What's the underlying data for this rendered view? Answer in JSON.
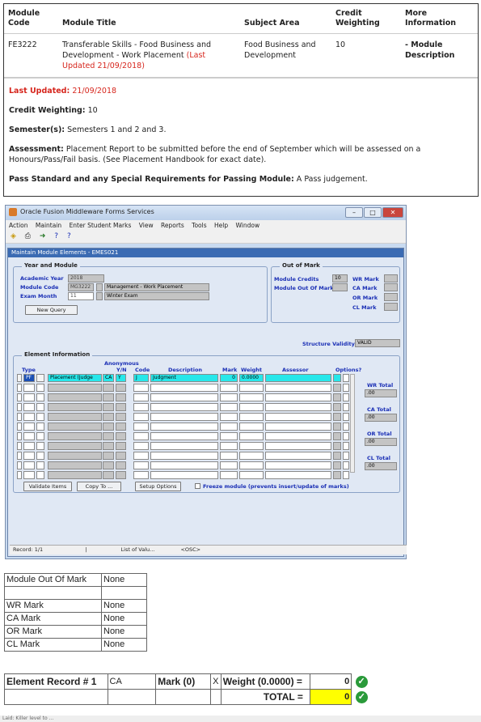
{
  "module_info": {
    "headers": [
      "Module Code",
      "Module Title",
      "Subject Area",
      "Credit Weighting",
      "More Information"
    ],
    "row": {
      "code": "FE3222",
      "title": "Transferable Skills - Food Business and Development - Work Placement",
      "title_updated": "(Last Updated 21/09/2018)",
      "subject": "Food Business and Development",
      "credit": "10",
      "more": "- Module Description"
    },
    "last_updated_label": "Last Updated:",
    "last_updated_value": "21/09/2018",
    "credit_weighting_label": "Credit Weighting:",
    "credit_weighting_value": "10",
    "semesters_label": "Semester(s):",
    "semesters_value": "Semesters 1 and 2 and 3.",
    "assessment_label": "Assessment:",
    "assessment_value": "Placement Report to be submitted before the end of September which will be assessed on a Honours/Pass/Fail basis. (See Placement Handbook for exact date).",
    "pass_label": "Pass Standard and any Special Requirements for Passing Module:",
    "pass_value": "A Pass judgement."
  },
  "oracle": {
    "window_title": "Oracle Fusion Middleware Forms Services",
    "menu": [
      "Action",
      "Maintain",
      "Enter Student Marks",
      "View",
      "Reports",
      "Tools",
      "Help",
      "Window"
    ],
    "inner_title": "Maintain Module Elements - EMES021",
    "year_module_legend": "Year and Module",
    "academic_year_label": "Academic Year",
    "academic_year_value": "2018",
    "module_code_label": "Module Code",
    "module_code_value": "MG3222",
    "module_name": "Management - Work Placement",
    "exam_month_label": "Exam Month",
    "exam_month_value": "11",
    "exam_name": "Winter Exam",
    "new_query": "New Query",
    "out_of_mark_legend": "Out of Mark",
    "module_credits_label": "Module Credits",
    "module_credits_value": "10",
    "module_out_of_mark_label": "Module Out Of Mark",
    "wr_mark": "WR Mark",
    "ca_mark": "CA Mark",
    "or_mark": "OR Mark",
    "cl_mark": "CL Mark",
    "structure_validity_label": "Structure Validity",
    "structure_validity_value": "VALID",
    "element_info_legend": "Element Information",
    "col_type": "Type",
    "col_anon": "Anonymous",
    "col_yn": "Y/N",
    "col_code": "Code",
    "col_desc": "Description",
    "col_mark": "Mark",
    "col_weight": "Weight",
    "col_assessor": "Assessor",
    "col_options": "Options?",
    "row1": {
      "type": "PF",
      "name": "Placement (Judge",
      "ca": "CA",
      "yn": "Y",
      "code": "J",
      "desc": "Judgment",
      "mark": "0",
      "weight": "0.0000"
    },
    "wr_total_label": "WR Total",
    "wr_total": ".00",
    "ca_total_label": "CA Total",
    "ca_total": ".00",
    "or_total_label": "OR Total",
    "or_total": ".00",
    "cl_total_label": "CL Total",
    "cl_total": ".00",
    "validate_items": "Validate Items",
    "copy_to": "Copy To ...",
    "setup_options": "Setup Options",
    "freeze_label": "Freeze module (prevents insert/update of marks)",
    "status_record": "Record: 1/1",
    "status_lov": "List of Valu...",
    "status_osc": "<OSC>"
  },
  "marks_table": [
    [
      "Module Out Of Mark",
      "None"
    ],
    [
      "",
      ""
    ],
    [
      "WR Mark",
      "None"
    ],
    [
      "CA Mark",
      "None"
    ],
    [
      "OR Mark",
      "None"
    ],
    [
      "CL Mark",
      "None"
    ]
  ],
  "element_table": {
    "label": "Element Record # 1",
    "type": "CA",
    "mark_label": "Mark (0)",
    "x": "X",
    "weight_label": "Weight (0.0000) =",
    "value": "0",
    "total_label": "TOTAL =",
    "total_value": "0"
  },
  "footer_text": "Laid: Killer level to ..."
}
